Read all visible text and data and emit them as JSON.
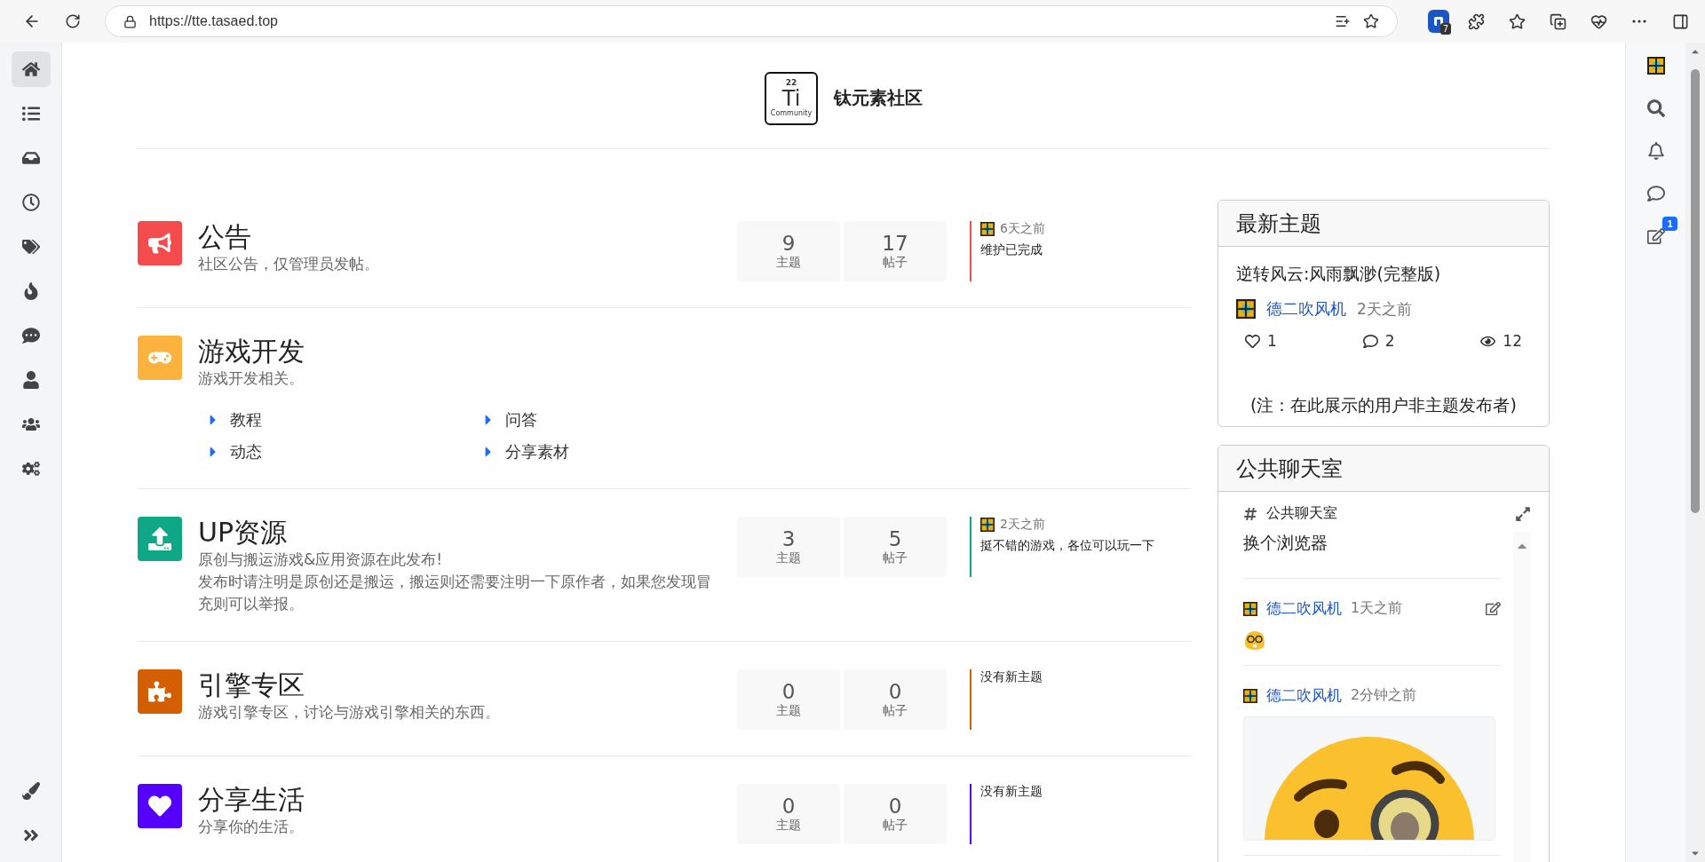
{
  "browser": {
    "url": "https://tte.tasaed.top",
    "extension_badge": "7"
  },
  "site": {
    "title": "钛元素社区",
    "logo": {
      "number": "22",
      "symbol": "Ti",
      "caption": "Community"
    }
  },
  "left_nav": [
    {
      "kind": "home",
      "selected": true
    },
    {
      "kind": "list",
      "selected": false
    },
    {
      "kind": "inbox",
      "selected": false
    },
    {
      "kind": "clock",
      "selected": false
    },
    {
      "kind": "tags",
      "selected": false
    },
    {
      "kind": "fire",
      "selected": false
    },
    {
      "kind": "chat",
      "selected": false
    },
    {
      "kind": "user",
      "selected": false
    },
    {
      "kind": "users",
      "selected": false
    },
    {
      "kind": "cogs",
      "selected": false
    }
  ],
  "right_nav": [
    {
      "kind": "avatar"
    },
    {
      "kind": "search"
    },
    {
      "kind": "bell"
    },
    {
      "kind": "chat"
    },
    {
      "kind": "compose",
      "badge": "1"
    }
  ],
  "categories": [
    {
      "kind": "bullhorn",
      "color": "#f44c4c",
      "title": "公告",
      "description": [
        "社区公告，仅管理员发帖。"
      ],
      "stats": [
        {
          "value": "9",
          "label": "主题"
        },
        {
          "value": "17",
          "label": "帖子"
        }
      ],
      "last_post": {
        "time": "6天之前",
        "text": "维护已完成"
      }
    },
    {
      "kind": "gamepad",
      "color": "#fbb33d",
      "title": "游戏开发",
      "description": [
        "游戏开发相关。"
      ],
      "subcategories": [
        "教程",
        "问答",
        "动态",
        "分享素材"
      ]
    },
    {
      "kind": "upload",
      "color": "#0fa887",
      "title": "UP资源",
      "description": [
        "原创与搬运游戏&应用资源在此发布!",
        "发布时请注明是原创还是搬运，搬运则还需要注明一下原作者，如果您发现冒充则可以举报。"
      ],
      "stats": [
        {
          "value": "3",
          "label": "主题"
        },
        {
          "value": "5",
          "label": "帖子"
        }
      ],
      "last_post": {
        "time": "2天之前",
        "text": "挺不错的游戏，各位可以玩一下"
      }
    },
    {
      "kind": "puzzle",
      "color": "#d35f00",
      "title": "引擎专区",
      "description": [
        "游戏引擎专区，讨论与游戏引擎相关的东西。"
      ],
      "stats": [
        {
          "value": "0",
          "label": "主题"
        },
        {
          "value": "0",
          "label": "帖子"
        }
      ],
      "no_posts": "没有新主题"
    },
    {
      "kind": "heart",
      "color": "#5500ff",
      "title": "分享生活",
      "description": [
        "分享你的生活。"
      ],
      "stats": [
        {
          "value": "0",
          "label": "主题"
        },
        {
          "value": "0",
          "label": "帖子"
        }
      ],
      "no_posts": "没有新主题"
    }
  ],
  "latest_topics": {
    "heading": "最新主题",
    "title": "逆转风云:风雨飘渺(完整版)",
    "user": "德二吹风机",
    "time": "2天之前",
    "likes": "1",
    "replies": "2",
    "views": "12",
    "note": "(注：在此展示的用户非主题发布者)"
  },
  "chat": {
    "heading": "公共聊天室",
    "room": "公共聊天室",
    "last_message": "换个浏览器",
    "messages": [
      {
        "user": "德二吹风机",
        "time": "1天之前",
        "editable": true,
        "kind": "emoji"
      },
      {
        "user": "德二吹风机",
        "time": "2分钟之前",
        "editable": false,
        "kind": "sticker"
      }
    ]
  }
}
